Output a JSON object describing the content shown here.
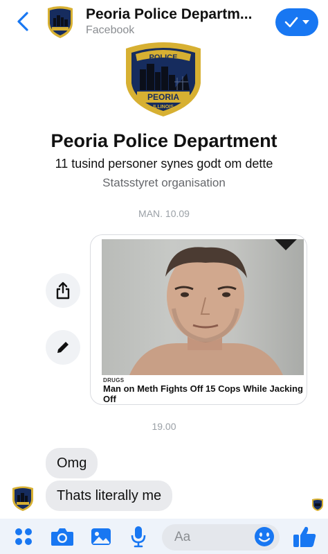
{
  "header": {
    "title": "Peoria Police Departm...",
    "subtitle": "Facebook"
  },
  "profile": {
    "name": "Peoria Police Department",
    "likes": "11 tusind personer synes godt om dette",
    "category": "Statsstyret organisation",
    "badge_top": "POLICE",
    "badge_city": "PEORIA",
    "badge_state": "ILLINOIS"
  },
  "thread": {
    "date_label": "MAN. 10.09",
    "time_label": "19.00",
    "shared_post": {
      "tag": "DRUGS",
      "headline": "Man on Meth Fights Off 15 Cops While Jacking Off"
    },
    "messages": [
      {
        "text": "Omg"
      },
      {
        "text": "Thats literally me"
      }
    ]
  },
  "composer": {
    "placeholder": "Aa"
  },
  "colors": {
    "accent": "#1877f2",
    "bubble": "#e9eaed",
    "badge_navy": "#162c5e",
    "badge_gold": "#d7b032"
  }
}
